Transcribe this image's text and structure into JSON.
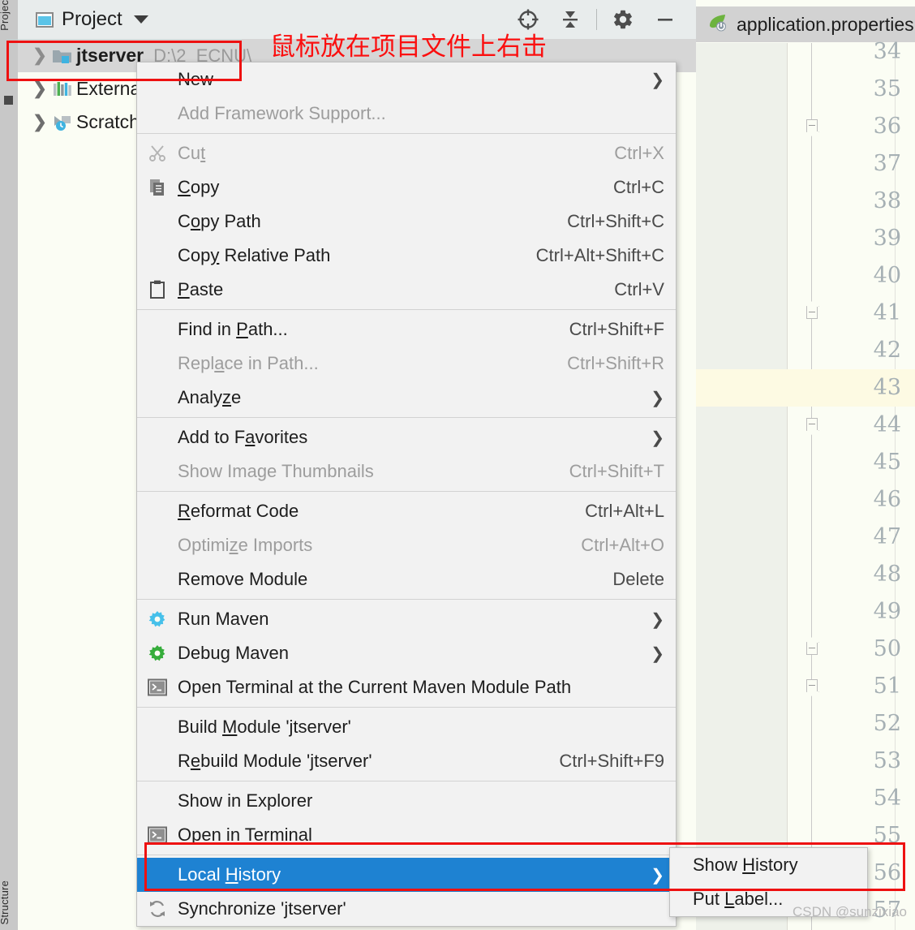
{
  "window": {
    "vertical_tabs": {
      "top": "Project",
      "bottom": "Structure"
    }
  },
  "project_panel": {
    "title": "Project",
    "toolbar": [
      {
        "name": "locate-icon",
        "label": "Select Opened File"
      },
      {
        "name": "collapse-all-icon",
        "label": "Collapse All"
      },
      {
        "name": "gear-icon",
        "label": "Settings"
      },
      {
        "name": "minimize-icon",
        "label": "Hide"
      }
    ],
    "tree": [
      {
        "label": "jtserver",
        "path": "D:\\2_ECNU\\",
        "icon": "module-folder-icon",
        "selected": true,
        "bold": true
      },
      {
        "label": "External Libraries",
        "icon": "libraries-icon",
        "selected": false,
        "bold": false
      },
      {
        "label": "Scratches and Consoles",
        "icon": "scratches-icon",
        "selected": false,
        "bold": false
      }
    ]
  },
  "editor": {
    "tab_label": "application.properties",
    "tab_icon": "spring-leaf-icon",
    "line_numbers": [
      34,
      35,
      36,
      37,
      38,
      39,
      40,
      41,
      42,
      43,
      44,
      45,
      46,
      47,
      48,
      49,
      50,
      51,
      52,
      53,
      54,
      55,
      56,
      57
    ],
    "highlighted_line": 43,
    "fold_markers": [
      36,
      41,
      44,
      50,
      51
    ]
  },
  "context_menu": {
    "items": [
      {
        "label": "New",
        "accel": "",
        "icon": "",
        "disabled": false,
        "submenu": true,
        "underline_index": -1
      },
      {
        "label": "Add Framework Support...",
        "accel": "",
        "icon": "",
        "disabled": true,
        "submenu": false
      },
      {
        "separator": true
      },
      {
        "label": "Cut",
        "accel": "Ctrl+X",
        "icon": "scissors-icon",
        "disabled": true,
        "underline": "t"
      },
      {
        "label": "Copy",
        "accel": "Ctrl+C",
        "icon": "copy-icon",
        "disabled": false,
        "underline": "C"
      },
      {
        "label": "Copy Path",
        "accel": "Ctrl+Shift+C",
        "icon": "",
        "disabled": false,
        "underline": "o"
      },
      {
        "label": "Copy Relative Path",
        "accel": "Ctrl+Alt+Shift+C",
        "icon": "",
        "disabled": false,
        "underline": "y"
      },
      {
        "label": "Paste",
        "accel": "Ctrl+V",
        "icon": "clipboard-icon",
        "disabled": false,
        "underline": "P"
      },
      {
        "separator": true
      },
      {
        "label": "Find in Path...",
        "accel": "Ctrl+Shift+F",
        "icon": "",
        "disabled": false,
        "underline": "P"
      },
      {
        "label": "Replace in Path...",
        "accel": "Ctrl+Shift+R",
        "icon": "",
        "disabled": true,
        "underline": "a"
      },
      {
        "label": "Analyze",
        "accel": "",
        "icon": "",
        "disabled": false,
        "submenu": true,
        "underline": "z"
      },
      {
        "separator": true
      },
      {
        "label": "Add to Favorites",
        "accel": "",
        "icon": "",
        "disabled": false,
        "submenu": true,
        "underline": "a"
      },
      {
        "label": "Show Image Thumbnails",
        "accel": "Ctrl+Shift+T",
        "icon": "",
        "disabled": true
      },
      {
        "separator": true
      },
      {
        "label": "Reformat Code",
        "accel": "Ctrl+Alt+L",
        "icon": "",
        "disabled": false,
        "underline": "R"
      },
      {
        "label": "Optimize Imports",
        "accel": "Ctrl+Alt+O",
        "icon": "",
        "disabled": true,
        "underline": "z"
      },
      {
        "label": "Remove Module",
        "accel": "Delete",
        "icon": "",
        "disabled": false
      },
      {
        "separator": true
      },
      {
        "label": "Run Maven",
        "accel": "",
        "icon": "run-maven-icon",
        "disabled": false,
        "submenu": true
      },
      {
        "label": "Debug Maven",
        "accel": "",
        "icon": "debug-maven-icon",
        "disabled": false,
        "submenu": true
      },
      {
        "label": "Open Terminal at the Current Maven Module Path",
        "accel": "",
        "icon": "terminal-icon",
        "disabled": false
      },
      {
        "separator": true
      },
      {
        "label": "Build Module 'jtserver'",
        "accel": "",
        "icon": "",
        "disabled": false,
        "underline": "M"
      },
      {
        "label": "Rebuild Module 'jtserver'",
        "accel": "Ctrl+Shift+F9",
        "icon": "",
        "disabled": false,
        "underline": "e"
      },
      {
        "separator": true
      },
      {
        "label": "Show in Explorer",
        "accel": "",
        "icon": "",
        "disabled": false
      },
      {
        "label": "Open in Terminal",
        "accel": "",
        "icon": "terminal-icon",
        "disabled": false
      },
      {
        "separator": true
      },
      {
        "label": "Local History",
        "accel": "",
        "icon": "",
        "disabled": false,
        "submenu": true,
        "highlight": true,
        "underline": "H"
      },
      {
        "label": "Synchronize 'jtserver'",
        "accel": "",
        "icon": "sync-icon",
        "disabled": false
      }
    ]
  },
  "submenu": {
    "items": [
      {
        "label": "Show History",
        "underline": "H"
      },
      {
        "label": "Put Label...",
        "underline": "L"
      }
    ]
  },
  "annotations": {
    "chinese_note": "鼠标放在项目文件上右击",
    "watermark": "CSDN @sunzixiao",
    "highlight_color": "#1e82d2",
    "annotation_color": "#fb0f0f"
  }
}
